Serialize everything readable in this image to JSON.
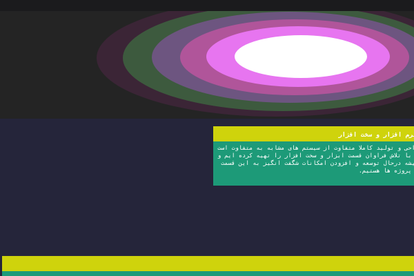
{
  "colors": {
    "page_background": "#25253a",
    "top_bar": "#1b1b1d",
    "hero_background": "#242424",
    "card_header": "#cfd30c",
    "card_body": "#1d9a78",
    "text": "#ffffff",
    "ring_outer": "#3b2536",
    "ring_green": "#3d5a3e",
    "ring_mauve": "#6d5580",
    "ring_pink": "#b0559a",
    "ring_violet": "#e775f0",
    "ring_center": "#ffffff"
  },
  "hero": {
    "graphic": "concentric-ellipses-graphic"
  },
  "software_card": {
    "title": "نرم افزار و سخت افزار",
    "body": "طراحی و تولید کاملا متفاوت از سیستم های مشابه به متفاوت است ما با تلاش فراوان قسمت ابزار و سخت افزار را تهیه کرده ایم و همیشه درحال توسعه و افزودن امکانات شگفت انگیز به این قسمت از پروژه ها هستیم."
  }
}
